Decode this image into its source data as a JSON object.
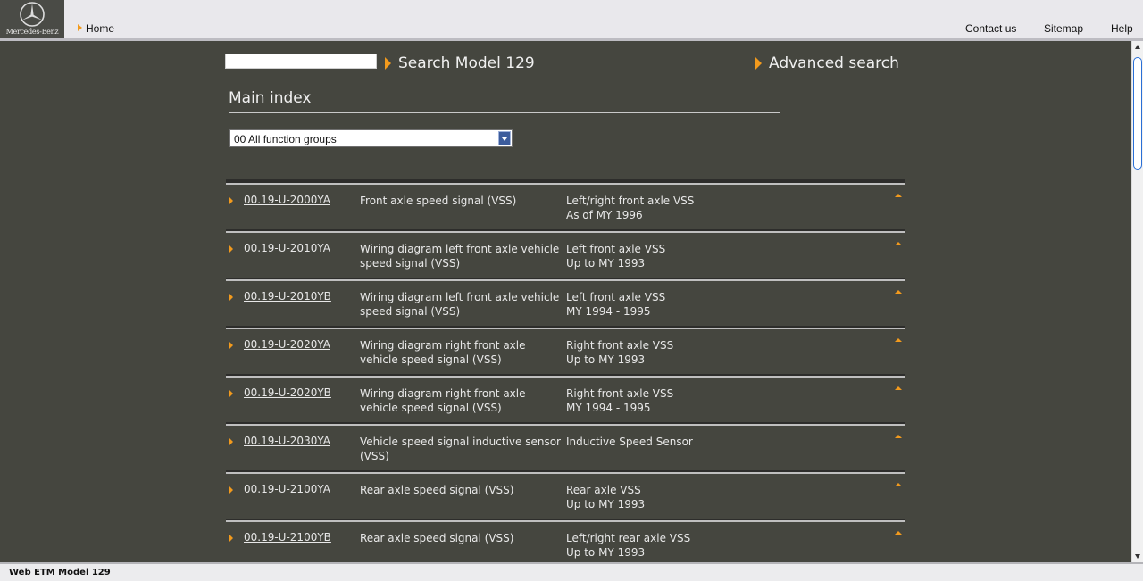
{
  "header": {
    "brand": "Mercedes-Benz",
    "home_label": "Home",
    "links": [
      "Contact us",
      "Sitemap",
      "Help"
    ]
  },
  "search": {
    "input_value": "",
    "search_label": "Search Model 129",
    "advanced_label": "Advanced search"
  },
  "main": {
    "title": "Main index",
    "select_value": "00 All function groups",
    "rows": [
      {
        "code": "00.19-U-2000YA",
        "title": "Front axle speed signal (VSS)",
        "desc1": "Left/right front axle VSS",
        "desc2": "As of MY 1996"
      },
      {
        "code": "00.19-U-2010YA",
        "title": "Wiring diagram left front axle vehicle speed signal (VSS)",
        "desc1": "Left front axle VSS",
        "desc2": "Up to MY 1993"
      },
      {
        "code": "00.19-U-2010YB",
        "title": "Wiring diagram left front axle vehicle speed signal (VSS)",
        "desc1": "Left front axle VSS",
        "desc2": "MY 1994 - 1995"
      },
      {
        "code": "00.19-U-2020YA",
        "title": "Wiring diagram right front axle vehicle speed signal (VSS)",
        "desc1": "Right front axle VSS",
        "desc2": "Up to MY 1993"
      },
      {
        "code": "00.19-U-2020YB",
        "title": "Wiring diagram right front axle vehicle speed signal (VSS)",
        "desc1": "Right front axle VSS",
        "desc2": "MY 1994 - 1995"
      },
      {
        "code": "00.19-U-2030YA",
        "title": "Vehicle speed signal inductive sensor (VSS)",
        "desc1": "Inductive Speed Sensor",
        "desc2": ""
      },
      {
        "code": "00.19-U-2100YA",
        "title": "Rear axle speed signal (VSS)",
        "desc1": "Rear axle VSS",
        "desc2": "Up to MY 1993"
      },
      {
        "code": "00.19-U-2100YB",
        "title": "Rear axle speed signal (VSS)",
        "desc1": "Left/right rear axle VSS",
        "desc2": "Up to MY 1993"
      }
    ]
  },
  "footer": {
    "text": "Web ETM Model 129"
  },
  "colors": {
    "accent": "#f29a1d",
    "background": "#45463f",
    "select_button": "#3c5c9c"
  },
  "icons": [
    "mercedes-star-icon",
    "triangle-bullet-icon",
    "scroll-to-top-icon",
    "chevron-down-icon"
  ]
}
